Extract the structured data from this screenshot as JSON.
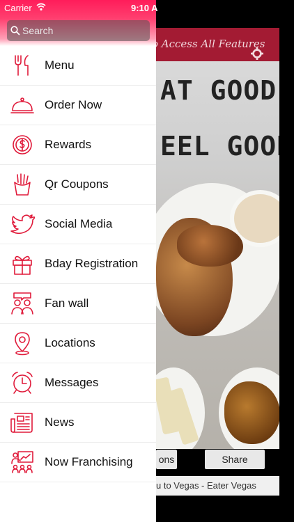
{
  "status_bar": {
    "carrier": "Carrier",
    "time": "9:10 A"
  },
  "search": {
    "placeholder": "Search"
  },
  "menu": [
    {
      "label": "Menu",
      "icon": "utensils-icon"
    },
    {
      "label": "Order Now",
      "icon": "cloche-icon"
    },
    {
      "label": "Rewards",
      "icon": "dollar-coin-icon"
    },
    {
      "label": "Qr Coupons",
      "icon": "fries-icon"
    },
    {
      "label": "Social Media",
      "icon": "twitter-bird-icon"
    },
    {
      "label": "Bday Registration",
      "icon": "gift-icon"
    },
    {
      "label": "Fan wall",
      "icon": "people-chat-icon"
    },
    {
      "label": "Locations",
      "icon": "map-pin-icon"
    },
    {
      "label": "Messages",
      "icon": "alarm-clock-icon"
    },
    {
      "label": "News",
      "icon": "newspaper-icon"
    },
    {
      "label": "Now Franchising",
      "icon": "presentation-icon"
    }
  ],
  "background": {
    "banner_text": "o Access All Features",
    "headline_1": "AT GOOD",
    "headline_2": "EEL GOOD",
    "button_left": "ons",
    "button_share": "Share",
    "ticker": "u to Vegas - Eater Vegas"
  },
  "colors": {
    "accent": "#e01a3a",
    "header_top": "#ff1c5a",
    "banner": "#a31b33"
  }
}
